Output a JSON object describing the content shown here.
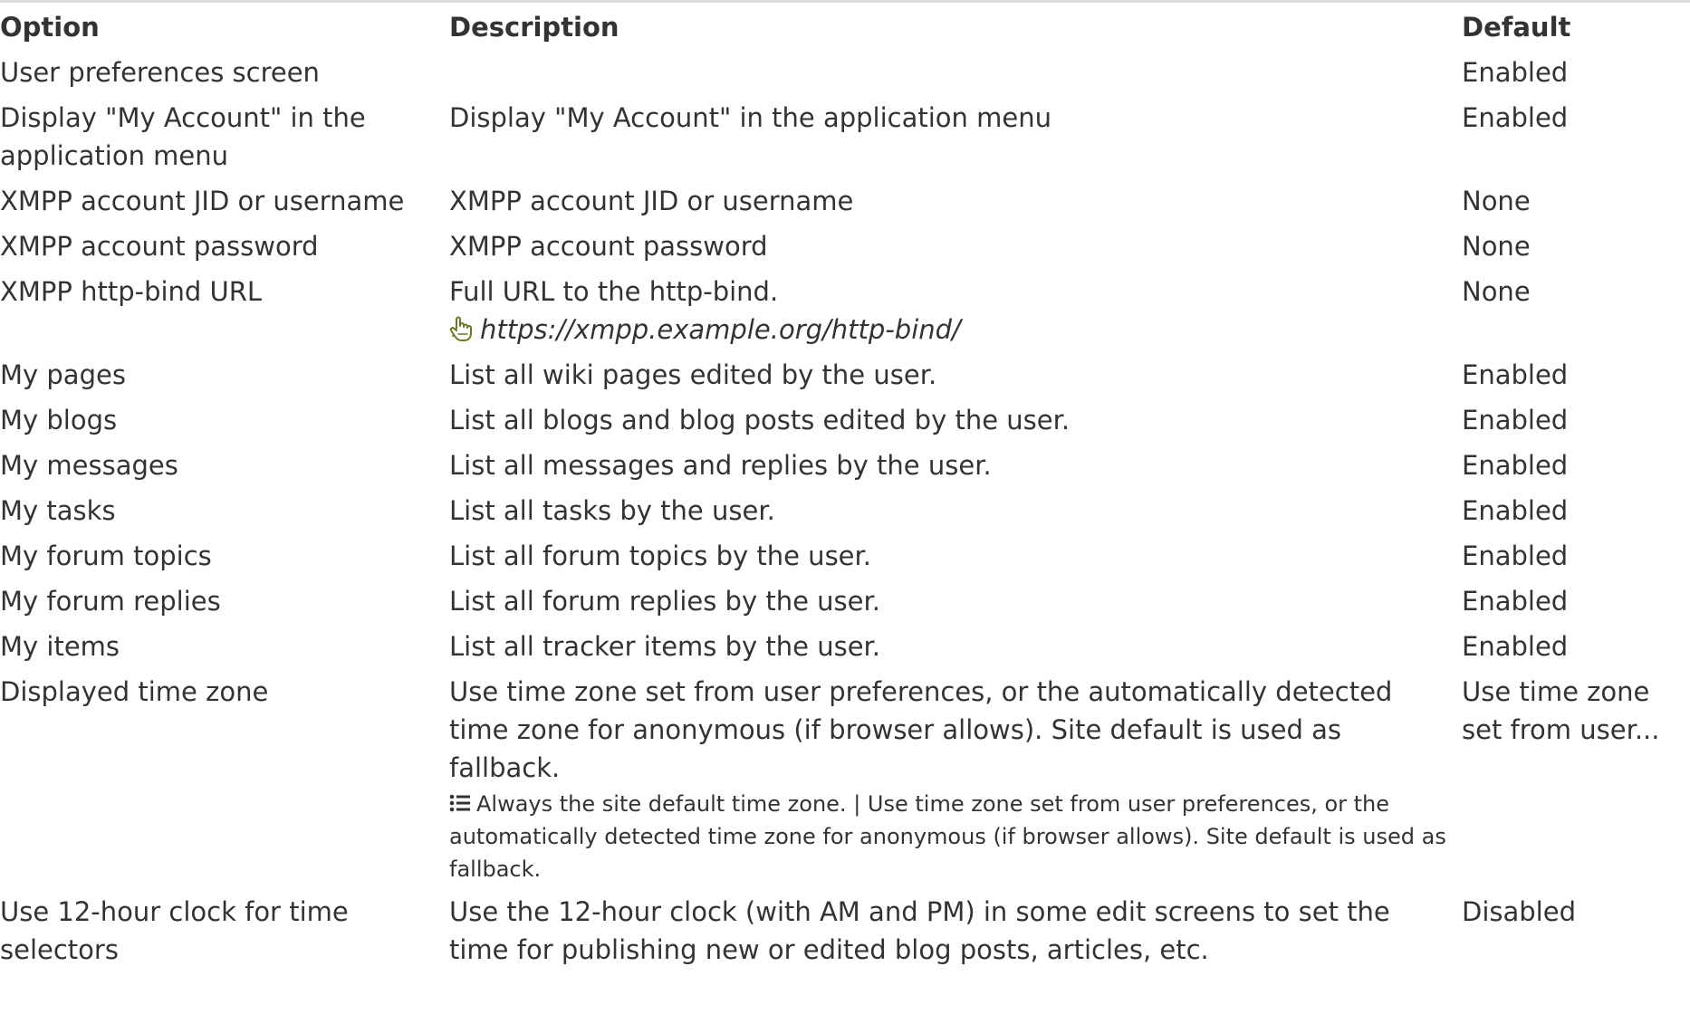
{
  "headers": {
    "option": "Option",
    "description": "Description",
    "default": "Default"
  },
  "rows": [
    {
      "option": "User preferences screen",
      "description": "",
      "default": "Enabled"
    },
    {
      "option": "Display \"My Account\" in the application menu",
      "description": "Display \"My Account\" in the application menu",
      "default": "Enabled"
    },
    {
      "option": "XMPP account JID or username",
      "description": "XMPP account JID or username",
      "default": "None"
    },
    {
      "option": "XMPP account password",
      "description": "XMPP account password",
      "default": "None"
    },
    {
      "option": "XMPP http-bind URL",
      "description": "Full URL to the http-bind.",
      "example": "https://xmpp.example.org/http-bind/",
      "default": "None"
    },
    {
      "option": "My pages",
      "description": "List all wiki pages edited by the user.",
      "default": "Enabled"
    },
    {
      "option": "My blogs",
      "description": "List all blogs and blog posts edited by the user.",
      "default": "Enabled"
    },
    {
      "option": "My messages",
      "description": "List all messages and replies by the user.",
      "default": "Enabled"
    },
    {
      "option": "My tasks",
      "description": "List all tasks by the user.",
      "default": "Enabled"
    },
    {
      "option": "My forum topics",
      "description": "List all forum topics by the user.",
      "default": "Enabled"
    },
    {
      "option": "My forum replies",
      "description": "List all forum replies by the user.",
      "default": "Enabled"
    },
    {
      "option": "My items",
      "description": "List all tracker items by the user.",
      "default": "Enabled"
    },
    {
      "option": "Displayed time zone",
      "description": "Use time zone set from user preferences, or the automatically detected time zone for anonymous (if browser allows). Site default is used as fallback.",
      "choices": "Always the site default time zone. | Use time zone set from user preferences, or the automatically detected time zone for anonymous (if browser allows). Site default is used as fallback.",
      "default": "Use time zone set from user..."
    },
    {
      "option": "Use 12-hour clock for time selectors",
      "description": "Use the 12-hour clock (with AM and PM) in some edit screens to set the time for publishing new or edited blog posts, articles, etc.",
      "default": "Disabled"
    }
  ],
  "colors": {
    "text": "#333333",
    "muted": "#8a8a8a",
    "icon": "#6b7a1f",
    "rule": "#dcdcdc"
  },
  "icons": {
    "example": "hand-pointer-icon",
    "choices": "list-icon"
  }
}
